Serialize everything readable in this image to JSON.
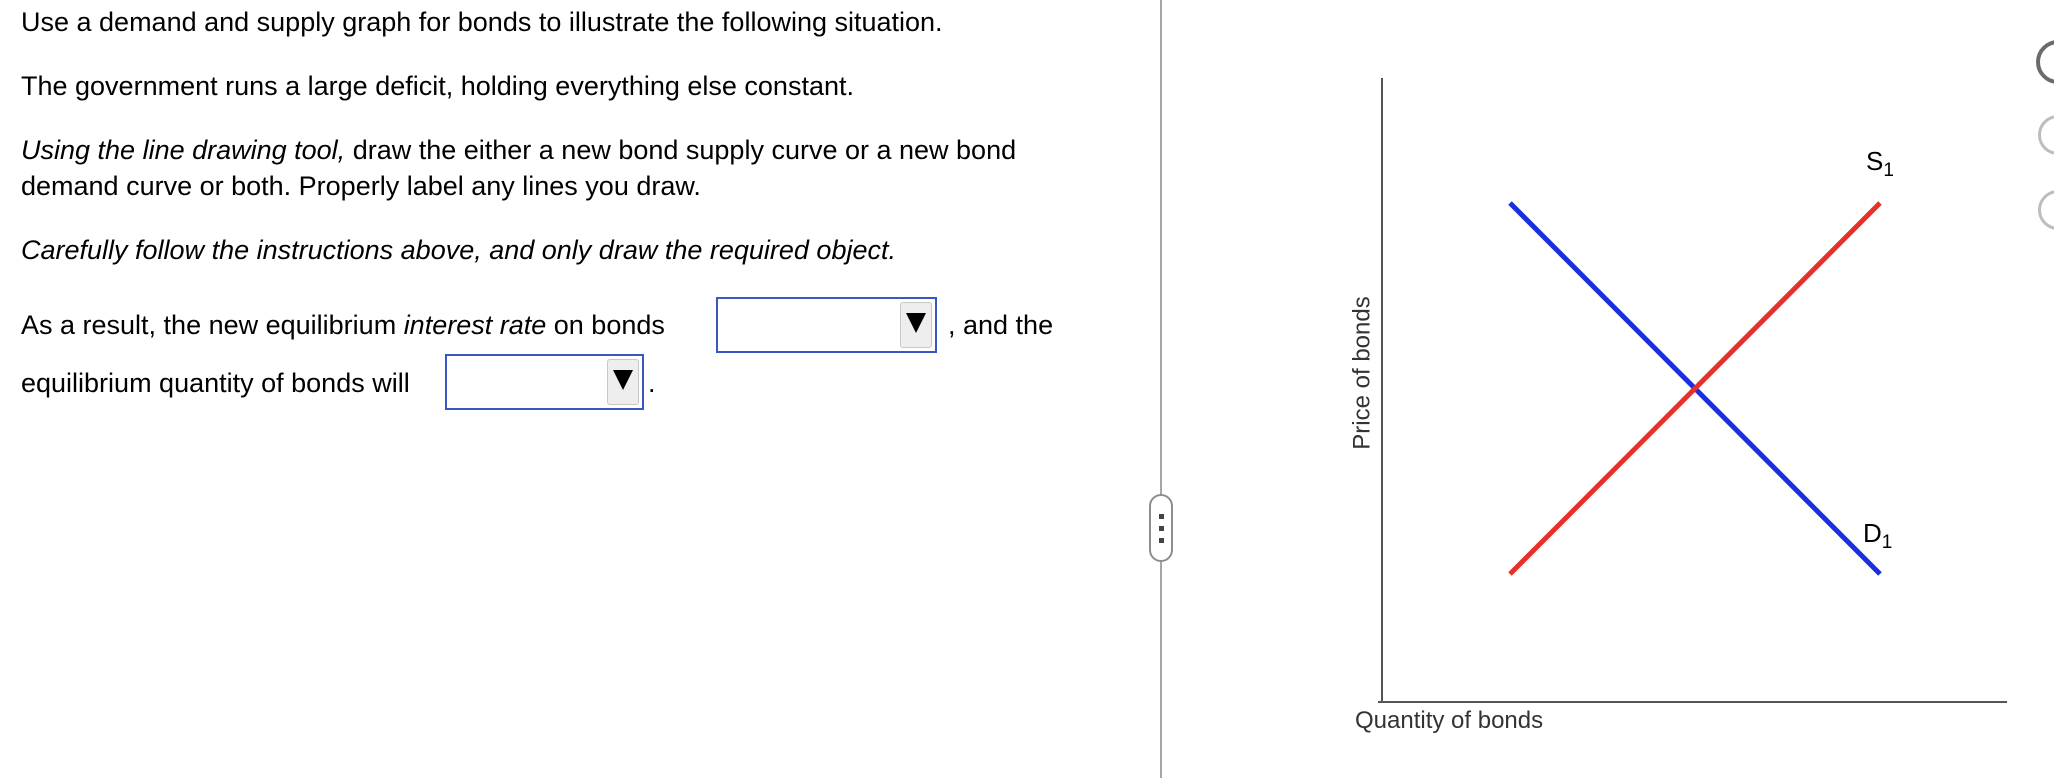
{
  "question": {
    "line1": "Use a demand and supply graph for bonds to illustrate the following situation.",
    "line2": "The government runs a large deficit, holding everything  else constant.",
    "instruction_italic": "Using the line drawing tool,",
    "instruction_rest": " draw the either a new bond supply curve or a new bond",
    "instruction_line2": "demand curve or both. Properly label any lines you draw.",
    "caution": "Carefully follow the instructions above, and only draw the required object.",
    "result_prefix": "As a result, the new equilibrium ",
    "result_italic": "interest rate",
    "result_suffix": " on bonds",
    "result_after_dropdown": ", and the",
    "quantity_prefix": "equilibrium quantity of bonds will",
    "quantity_suffix": "."
  },
  "dropdowns": {
    "interest_rate": {
      "value": ""
    },
    "quantity": {
      "value": ""
    }
  },
  "graph": {
    "y_axis_label": "Price of bonds",
    "x_axis_label": "Quantity of bonds",
    "supply": {
      "label": "S",
      "subscript": "1",
      "color": "#e8302a"
    },
    "demand": {
      "label": "D",
      "subscript": "1",
      "color": "#1a2fe0"
    }
  },
  "colors": {
    "dropdown_border": "#3a56c4",
    "axis": "#555555"
  },
  "icons": {
    "tool_1": "tool-icon",
    "tool_2": "tool-icon",
    "tool_3": "tool-icon"
  }
}
